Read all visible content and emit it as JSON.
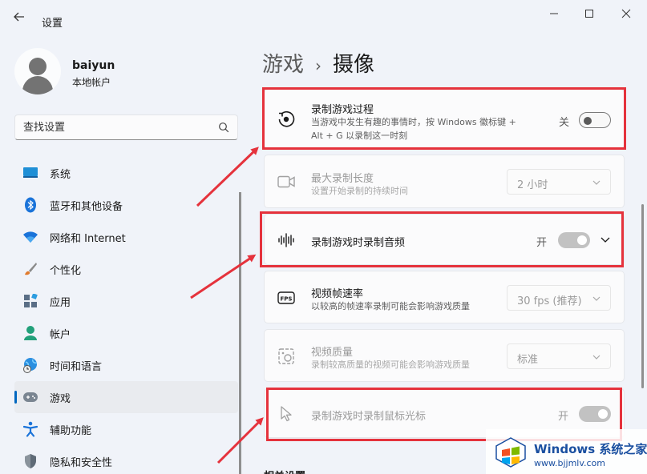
{
  "window": {
    "title": "设置",
    "back_icon": "back-arrow-icon",
    "minimize_icon": "minimize-icon",
    "maximize_icon": "maximize-icon",
    "close_icon": "close-icon"
  },
  "user": {
    "name": "baiyun",
    "account_type": "本地帐户"
  },
  "search": {
    "placeholder": "查找设置",
    "icon": "search-icon"
  },
  "sidebar": {
    "items": [
      {
        "label": "系统",
        "icon": "system-icon",
        "active": false
      },
      {
        "label": "蓝牙和其他设备",
        "icon": "bluetooth-icon",
        "active": false
      },
      {
        "label": "网络和 Internet",
        "icon": "wifi-icon",
        "active": false
      },
      {
        "label": "个性化",
        "icon": "brush-icon",
        "active": false
      },
      {
        "label": "应用",
        "icon": "apps-icon",
        "active": false
      },
      {
        "label": "帐户",
        "icon": "account-icon",
        "active": false
      },
      {
        "label": "时间和语言",
        "icon": "globe-clock-icon",
        "active": false
      },
      {
        "label": "游戏",
        "icon": "gamepad-icon",
        "active": true
      },
      {
        "label": "辅助功能",
        "icon": "accessibility-icon",
        "active": false
      },
      {
        "label": "隐私和安全性",
        "icon": "shield-icon",
        "active": false
      }
    ]
  },
  "breadcrumb": {
    "parent": "游戏",
    "separator": "›",
    "current": "摄像"
  },
  "settings": {
    "record_game": {
      "title": "录制游戏过程",
      "desc_line1": "当游戏中发生有趣的事情时，按 Windows 徽标键 +",
      "desc_line2": "Alt + G 以录制这一时刻",
      "state_label": "关",
      "on": false,
      "icon": "record-icon"
    },
    "max_length": {
      "title": "最大录制长度",
      "desc": "设置开始录制的持续时间",
      "value": "2 小时",
      "icon": "camera-icon"
    },
    "record_audio": {
      "title": "录制游戏时录制音频",
      "state_label": "开",
      "on": true,
      "icon": "audio-wave-icon"
    },
    "frame_rate": {
      "title": "视频帧速率",
      "desc": "以较高的帧速率录制可能会影响游戏质量",
      "value": "30 fps (推荐)",
      "icon": "fps-icon"
    },
    "video_quality": {
      "title": "视频质量",
      "desc": "录制较高质量的视频可能会影响游戏质量",
      "value": "标准",
      "icon": "video-quality-icon"
    },
    "record_cursor": {
      "title": "录制游戏时录制鼠标光标",
      "state_label": "开",
      "on": true,
      "icon": "cursor-icon"
    }
  },
  "related_settings": "相关设置",
  "watermark": {
    "brand": "Windows 系统之家",
    "url": "www.bjjmlv.com"
  },
  "colors": {
    "annotation_red": "#e5323c",
    "accent": "#0067c0"
  }
}
